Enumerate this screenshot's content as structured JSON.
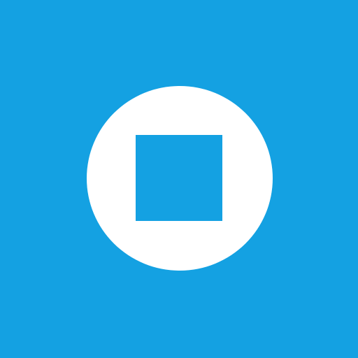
{
  "icon": {
    "name": "stop-icon",
    "background_color": "#14a1e2",
    "circle_color": "#ffffff",
    "square_color": "#14a1e2"
  }
}
